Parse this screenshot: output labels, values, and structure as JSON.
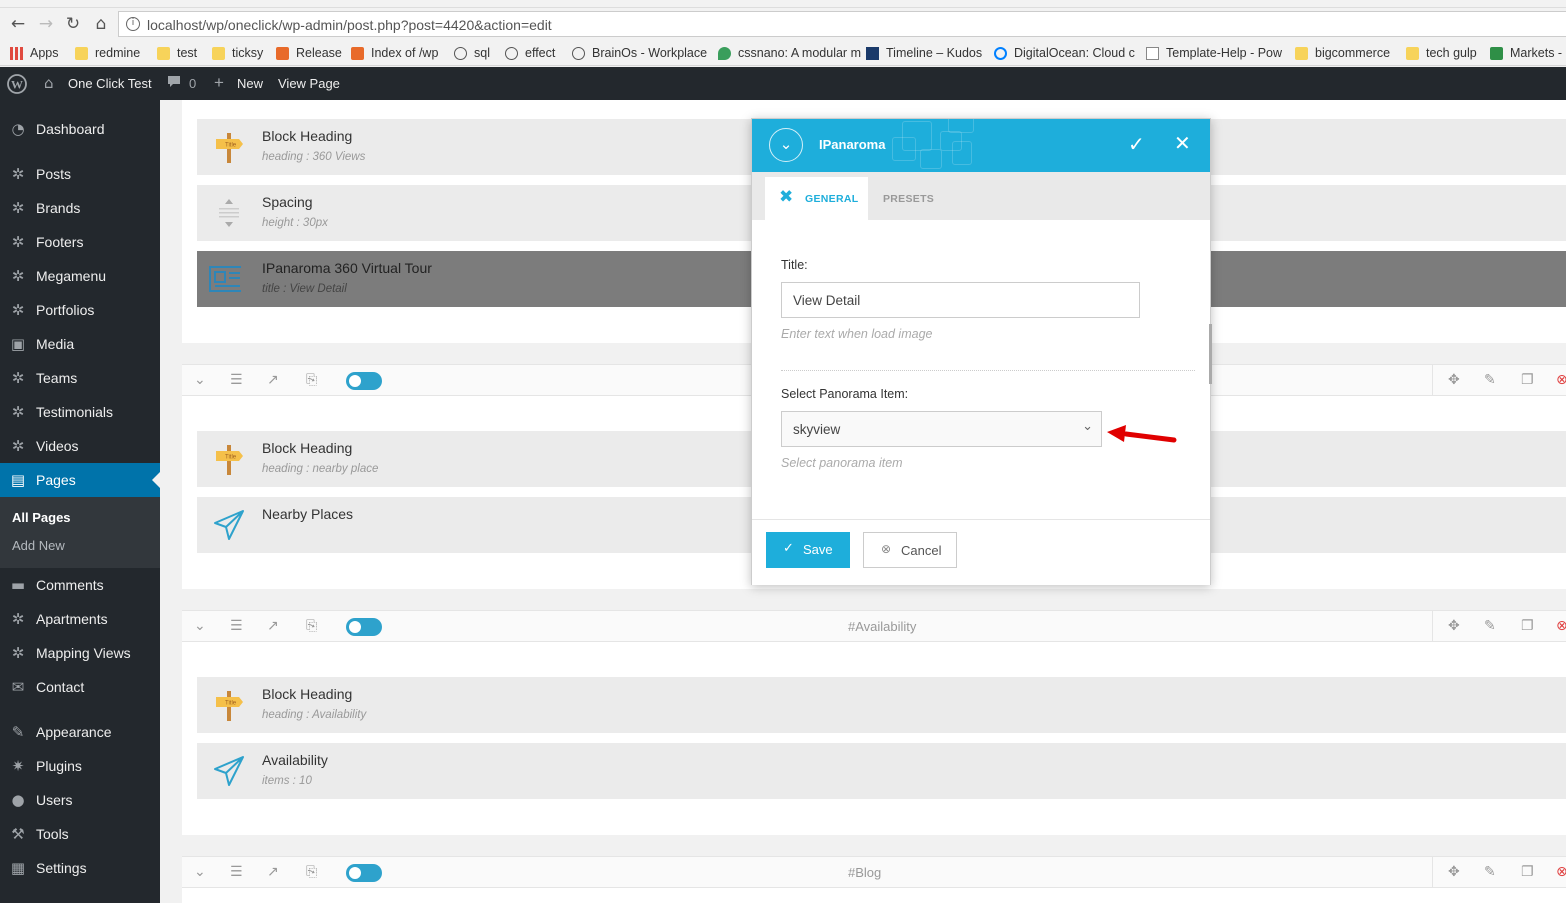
{
  "browser": {
    "url": "localhost/wp/oneclick/wp-admin/post.php?post=4420&action=edit",
    "bookmarks": [
      "Apps",
      "redmine",
      "test",
      "ticksy",
      "Release",
      "Index of /wp",
      "sql",
      "effect",
      "BrainOs - Workplace",
      "cssnano: A modular m",
      "Timeline – Kudos",
      "DigitalOcean: Cloud c",
      "Template-Help - Pow",
      "bigcommerce",
      "tech gulp",
      "Markets -"
    ]
  },
  "adminbar": {
    "site": "One Click Test",
    "comments": "0",
    "new": "New",
    "view": "View Page"
  },
  "sidebar": {
    "items": [
      "Dashboard",
      "Posts",
      "Brands",
      "Footers",
      "Megamenu",
      "Portfolios",
      "Media",
      "Teams",
      "Testimonials",
      "Videos",
      "Pages",
      "Comments",
      "Apartments",
      "Mapping Views",
      "Contact",
      "Appearance",
      "Plugins",
      "Users",
      "Tools",
      "Settings"
    ],
    "submenu": [
      "All Pages",
      "Add New"
    ]
  },
  "sections": [
    {
      "label": "",
      "elements": [
        {
          "title": "Block Heading",
          "sub": "heading : 360 Views"
        },
        {
          "title": "Spacing",
          "sub": "height : 30px"
        },
        {
          "title": "IPanaroma 360 Virtual Tour",
          "sub": "title : View Detail"
        }
      ]
    },
    {
      "label": "",
      "elements": [
        {
          "title": "Block Heading",
          "sub": "heading : nearby place"
        },
        {
          "title": "Nearby Places",
          "sub": ""
        }
      ]
    },
    {
      "label": "#Availability",
      "elements": [
        {
          "title": "Block Heading",
          "sub": "heading : Availability"
        },
        {
          "title": "Availability",
          "sub": "items : 10"
        }
      ]
    },
    {
      "label": "#Blog",
      "elements": []
    }
  ],
  "modal": {
    "title": "IPanaroma",
    "tabs": [
      "GENERAL",
      "PRESETS"
    ],
    "fields": {
      "title_label": "Title:",
      "title_value": "View Detail",
      "title_hint": "Enter text when load image",
      "select_label": "Select Panorama Item:",
      "select_value": "skyview",
      "select_hint": "Select panorama item"
    },
    "save": "Save",
    "cancel": "Cancel"
  },
  "colors": {
    "accent": "#1eaedb",
    "wp_blue": "#0073aa",
    "admin_dark": "#23282d",
    "arrow": "#e00000"
  }
}
